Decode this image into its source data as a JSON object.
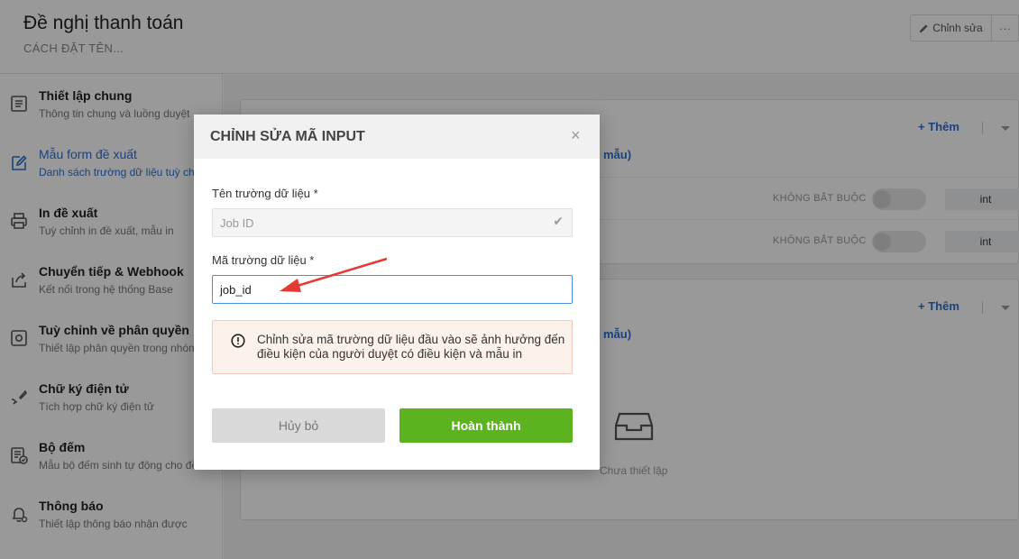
{
  "header": {
    "title": "Đề nghị thanh toán",
    "subtitle": "CÁCH ĐẶT TÊN...",
    "edit_label": "Chỉnh sửa",
    "more_label": "···"
  },
  "sidebar": {
    "items": [
      {
        "title": "Thiết lập chung",
        "desc": "Thông tin chung và luồng duyệt",
        "icon": "document-icon"
      },
      {
        "title": "Mẫu form đề xuất",
        "desc": "Danh sách trường dữ liệu tuỳ chỉnh",
        "icon": "edit-form-icon"
      },
      {
        "title": "In đề xuất",
        "desc": "Tuỳ chỉnh in đề xuất, mẫu in",
        "icon": "printer-icon"
      },
      {
        "title": "Chuyển tiếp & Webhook",
        "desc": "Kết nối trong hệ thống Base",
        "icon": "share-icon"
      },
      {
        "title": "Tuỳ chỉnh về phân quyền",
        "desc": "Thiết lập phân quyền trong nhóm",
        "icon": "settings-icon"
      },
      {
        "title": "Chữ ký điện tử",
        "desc": "Tích hợp chữ ký điện tử",
        "icon": "signature-icon"
      },
      {
        "title": "Bộ đếm",
        "desc": "Mẫu bộ đếm sinh tự động cho đề xuất",
        "icon": "counter-icon"
      },
      {
        "title": "Thông báo",
        "desc": "Thiết lập thông báo nhận được",
        "icon": "bell-icon"
      }
    ]
  },
  "main": {
    "add_label": "+ Thêm",
    "fragment_1": "mẫu)",
    "fragment_2": "mẫu)",
    "rows": [
      {
        "required": "KHÔNG BẮT BUỘC",
        "type": "int"
      },
      {
        "required": "KHÔNG BẮT BUỘC",
        "type": "int"
      }
    ],
    "empty_text": "Chưa thiết lập"
  },
  "modal": {
    "title": "CHỈNH SỬA MÃ INPUT",
    "close": "×",
    "field_name_label": "Tên trường dữ liệu *",
    "field_name_value": "Job ID",
    "field_code_label": "Mã trường dữ liệu *",
    "field_code_value": "job_id",
    "warning": "Chỉnh sửa mã trường dữ liệu đầu vào sẽ ảnh hưởng đến điều kiện của người duyệt có điều kiện và mẫu in",
    "cancel_label": "Hủy bỏ",
    "done_label": "Hoàn thành"
  },
  "colors": {
    "accent": "#2e6fd0",
    "primary_button": "#5cb31f",
    "annotation_arrow": "#e53935"
  }
}
